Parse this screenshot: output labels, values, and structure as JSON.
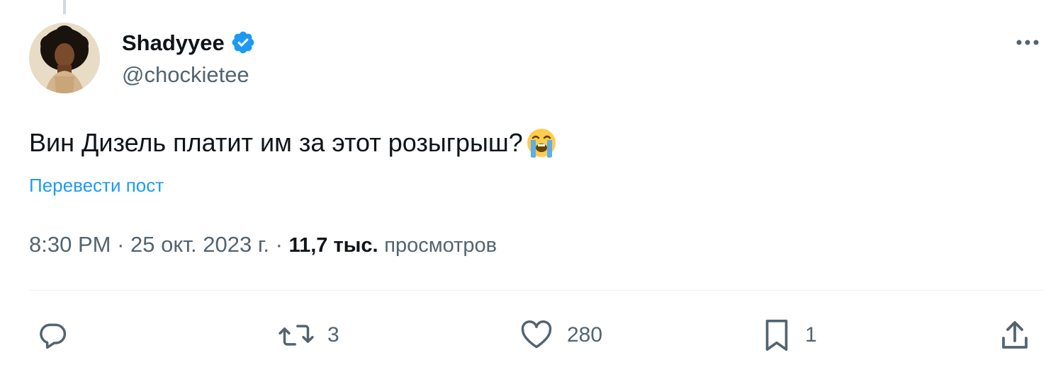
{
  "tweet": {
    "author": {
      "display_name": "Shadyyee",
      "handle": "@chockietee",
      "verified": true
    },
    "text": "Вин Дизель платит им за этот розыгрыш?",
    "emoji": "loudly-crying-face",
    "translate_label": "Перевести пост",
    "time": "8:30 PM",
    "separator": "·",
    "date": "25 окт. 2023 г.",
    "views_count": "11,7 тыс.",
    "views_label": "просмотров"
  },
  "actions": {
    "reply_count": "",
    "repost_count": "3",
    "like_count": "280",
    "bookmark_count": "1"
  },
  "colors": {
    "accent": "#1d9bf0",
    "text_primary": "#0f1419",
    "text_secondary": "#536471",
    "divider": "#eff3f4"
  }
}
